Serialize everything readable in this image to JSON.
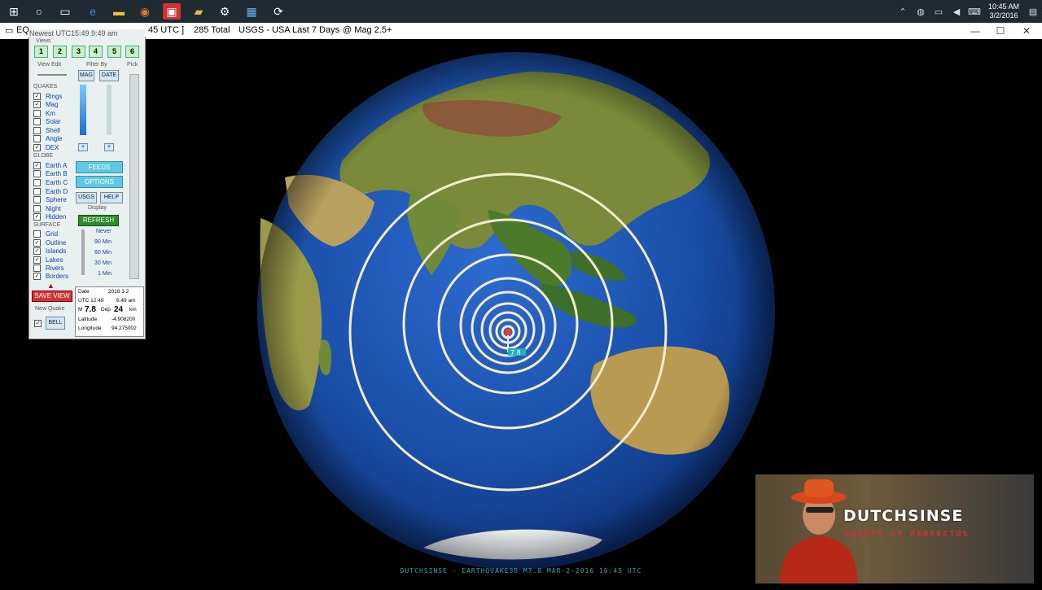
{
  "taskbar": {
    "icons": [
      "windows-start-icon",
      "cortana-circle-icon",
      "task-view-icon",
      "edge-browser-icon",
      "file-explorer-icon",
      "firefox-icon",
      "red-app-icon",
      "folder-icon",
      "settings-gear-icon",
      "blue-app-icon",
      "refresh-app-icon"
    ],
    "clock_time": "10:45 AM",
    "clock_date": "3/2/2016"
  },
  "titlebar": {
    "app_fragment": "EQ",
    "newest": "Newest UTC15:49  9:49 am",
    "utc_fragment": "45 UTC ]",
    "total": "285  Total",
    "source": "USGS  -  USA Last 7 Days",
    "mag": "@ Mag 2.5+"
  },
  "panel": {
    "views_label": "Views",
    "view_buttons": [
      "1",
      "2",
      "3",
      "4",
      "5",
      "6"
    ],
    "view_edit": "View Edit",
    "filter_by": "Filter By",
    "pick": "Pick",
    "mag_btn": "MAG",
    "date_btn": "DATE",
    "quakes_h": "QUAKES",
    "quakes": [
      {
        "label": "Rings",
        "checked": true
      },
      {
        "label": "Mag",
        "checked": true
      },
      {
        "label": "Km",
        "checked": false
      },
      {
        "label": "Solar",
        "checked": false
      },
      {
        "label": "Shell",
        "checked": false
      },
      {
        "label": "Angle",
        "checked": false
      },
      {
        "label": "DEX",
        "checked": true
      }
    ],
    "globe_h": "GLOBE",
    "globe": [
      {
        "label": "Earth A",
        "checked": true
      },
      {
        "label": "Earth B",
        "checked": false
      },
      {
        "label": "Earth C",
        "checked": false
      },
      {
        "label": "Earth D",
        "checked": false
      },
      {
        "label": "Sphere",
        "checked": false
      },
      {
        "label": "Night",
        "checked": false
      },
      {
        "label": "Hidden",
        "checked": true
      }
    ],
    "surface_h": "SURFACE",
    "surface": [
      {
        "label": "Grid",
        "checked": false
      },
      {
        "label": "Outline",
        "checked": true
      },
      {
        "label": "Islands",
        "checked": true
      },
      {
        "label": "Lakes",
        "checked": true
      },
      {
        "label": "Rivers",
        "checked": false
      },
      {
        "label": "Borders",
        "checked": true
      }
    ],
    "feeds_btn": "FEEDS",
    "options_btn": "OPTIONS",
    "usgs_btn": "USGS",
    "help_btn": "HELP",
    "display_h": "Display",
    "refresh_btn": "REFRESH",
    "display_options": [
      "Never",
      "90 Min",
      "60 Min",
      "30 Min",
      "1 Min"
    ],
    "save_view_btn": "SAVE VIEW",
    "new_quake": "New Quake",
    "bell_btn": "BELL",
    "info": {
      "date_label": "Date",
      "date_value": "2016  3  2",
      "utc_label": "UTC 12:49",
      "local_time": "6:49 am",
      "mag_label": "M",
      "mag_value": "7.8",
      "dep_label": "Dep",
      "dep_value": "24",
      "dep_unit": "km",
      "lat_label": "Latitude",
      "lat_value": "-4.908200",
      "lon_label": "Longitude",
      "lon_value": "94.275002"
    }
  },
  "globe_marker_label": "7.8",
  "webcam": {
    "brand": "DUTCHSINSE",
    "tagline": "ADEPTS of PERFECTUS"
  },
  "footer": "DUTCHSINSE - EARTHQUAKE3D  M7.8  MAR-2-2016  16:45 UTC",
  "colors": {
    "ocean": "#1a4fa8",
    "ring": "#f2ecd0",
    "taskbar": "#1f2a33"
  }
}
